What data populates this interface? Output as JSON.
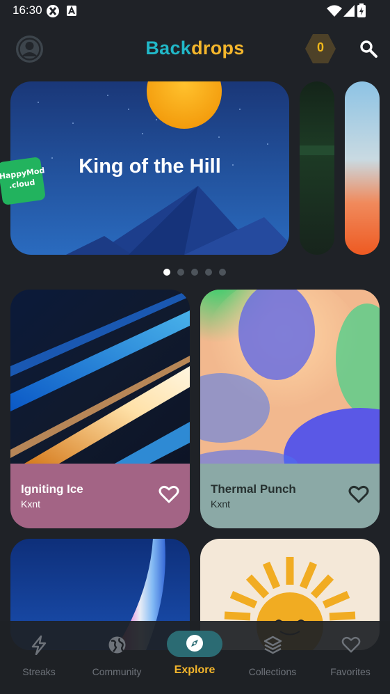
{
  "status": {
    "time": "16:30"
  },
  "header": {
    "brand_part1": "Back",
    "brand_part2": "drops",
    "coins": "0"
  },
  "carousel": {
    "featured_title": "King of the Hill",
    "page_count": 5,
    "active_index": 0
  },
  "watermark": {
    "line1": "HappyMod",
    "line2": ".cloud"
  },
  "wallpapers": [
    {
      "title": "Igniting Ice",
      "author": "Kxnt",
      "panel_color": "#a36485",
      "text_color": "#ffffff"
    },
    {
      "title": "Thermal Punch",
      "author": "Kxnt",
      "panel_color": "#8ba9a6",
      "text_color": "#26302f"
    }
  ],
  "nav": {
    "items": [
      {
        "label": "Streaks",
        "icon": "bolt-icon"
      },
      {
        "label": "Community",
        "icon": "globe-icon"
      },
      {
        "label": "Explore",
        "icon": "compass-icon",
        "active": true
      },
      {
        "label": "Collections",
        "icon": "layers-icon"
      },
      {
        "label": "Favorites",
        "icon": "heart-icon"
      }
    ]
  },
  "colors": {
    "background": "#1f2227",
    "accent_teal": "#21b8c8",
    "accent_gold": "#f4b62c"
  }
}
